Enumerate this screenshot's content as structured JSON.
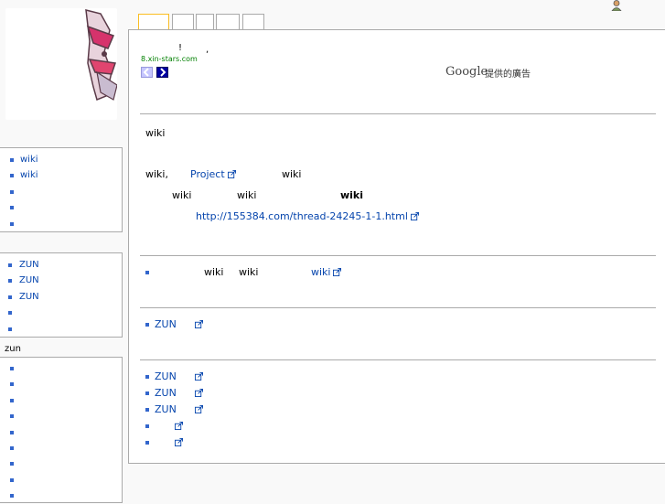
{
  "tabs": [
    {
      "label": ""
    },
    {
      "label": ""
    },
    {
      "label": ""
    },
    {
      "label": ""
    },
    {
      "label": ""
    }
  ],
  "ad": {
    "line1": "!",
    "comma": ",",
    "domain": "8.xin-stars.com",
    "google": "Google",
    "provided_by": "提供的廣告"
  },
  "main": {
    "heading": "wiki",
    "p1_a": "wiki,",
    "p1_link": "Project",
    "p1_b": "wiki",
    "p2_a": "wiki",
    "p2_b": "wiki",
    "p2_bold": "wiki",
    "p3_link": "http://155384.com/thread-24245-1-1.html",
    "s2_a": "wiki",
    "s2_b": "wiki",
    "s2_link": "wiki",
    "s3_link": "ZUN",
    "s4_links": [
      "ZUN",
      "ZUN",
      "ZUN",
      "",
      ""
    ]
  },
  "sidebar": {
    "portlet1": [
      "wiki",
      "wiki",
      "",
      "",
      ""
    ],
    "portlet2": [
      "ZUN",
      "ZUN",
      "ZUN",
      "",
      ""
    ],
    "portlet3_label": "zun",
    "portlet3": [
      "",
      "",
      "",
      "",
      "",
      "",
      "",
      "",
      ""
    ]
  },
  "colors": {
    "link": "#0645ad",
    "bullet": "#3366cc",
    "border": "#aaaaaa",
    "ad_domain": "#008000"
  }
}
